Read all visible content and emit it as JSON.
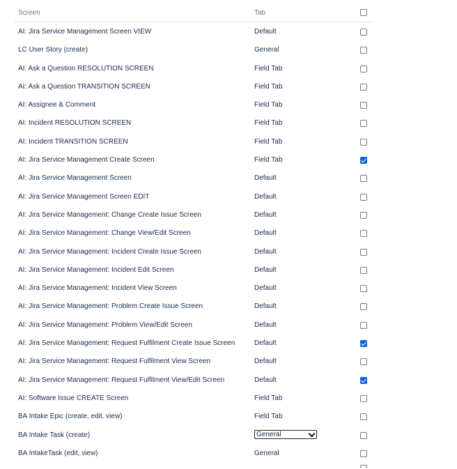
{
  "table": {
    "headers": {
      "screen": "Screen",
      "tab": "Tab"
    },
    "rows": [
      {
        "screen": "AI: Jira Service Management Screen VIEW",
        "tab": "Default",
        "checked": false
      },
      {
        "screen": "LC User Story (create)",
        "tab": "General",
        "checked": false
      },
      {
        "screen": "AI: Ask a Question RESOLUTION SCREEN",
        "tab": "Field Tab",
        "checked": false
      },
      {
        "screen": "AI: Ask a Question TRANSITION SCREEN",
        "tab": "Field Tab",
        "checked": false
      },
      {
        "screen": "AI: Assignee & Comment",
        "tab": "Field Tab",
        "checked": false
      },
      {
        "screen": "AI: Incident RESOLUTION SCREEN",
        "tab": "Field Tab",
        "checked": false
      },
      {
        "screen": "AI: Incident TRANSITION SCREEN",
        "tab": "Field Tab",
        "checked": false
      },
      {
        "screen": "AI: Jira Service Management Create Screen",
        "tab": "Field Tab",
        "checked": true
      },
      {
        "screen": "AI: Jira Service Management Screen",
        "tab": "Default",
        "checked": false
      },
      {
        "screen": "AI: Jira Service Management Screen EDIT",
        "tab": "Default",
        "checked": false
      },
      {
        "screen": "AI: Jira Service Management: Change Create Issue Screen",
        "tab": "Default",
        "checked": false
      },
      {
        "screen": "AI: Jira Service Management: Change View/Edit Screen",
        "tab": "Default",
        "checked": false
      },
      {
        "screen": "AI: Jira Service Management: Incident Create Issue Screen",
        "tab": "Default",
        "checked": false
      },
      {
        "screen": "AI: Jira Service Management: Incident Edit Screen",
        "tab": "Default",
        "checked": false
      },
      {
        "screen": "AI: Jira Service Management: Incident View Screen",
        "tab": "Default",
        "checked": false
      },
      {
        "screen": "AI: Jira Service Management: Problem Create Issue Screen",
        "tab": "Default",
        "checked": false
      },
      {
        "screen": "AI: Jira Service Management: Problem View/Edit Screen",
        "tab": "Default",
        "checked": false
      },
      {
        "screen": "AI: Jira Service Management: Request Fulfilment Create Issue Screen",
        "tab": "Default",
        "checked": true
      },
      {
        "screen": "AI: Jira Service Management: Request Fulfilment View Screen",
        "tab": "Default",
        "checked": false
      },
      {
        "screen": "AI: Jira Service Management: Request Fulfilment View/Edit Screen",
        "tab": "Default",
        "checked": true
      },
      {
        "screen": "AI: Software Issue CREATE Screen",
        "tab": "Field Tab",
        "checked": false
      },
      {
        "screen": "BA Intake Epic (create, edit, view)",
        "tab": "Field Tab",
        "checked": false
      },
      {
        "screen": "BA Intake Task (create)",
        "tab": "General",
        "checked": false,
        "is_select": true
      },
      {
        "screen": "BA IntakeTask (edit, view)",
        "tab": "General",
        "checked": false
      }
    ]
  }
}
